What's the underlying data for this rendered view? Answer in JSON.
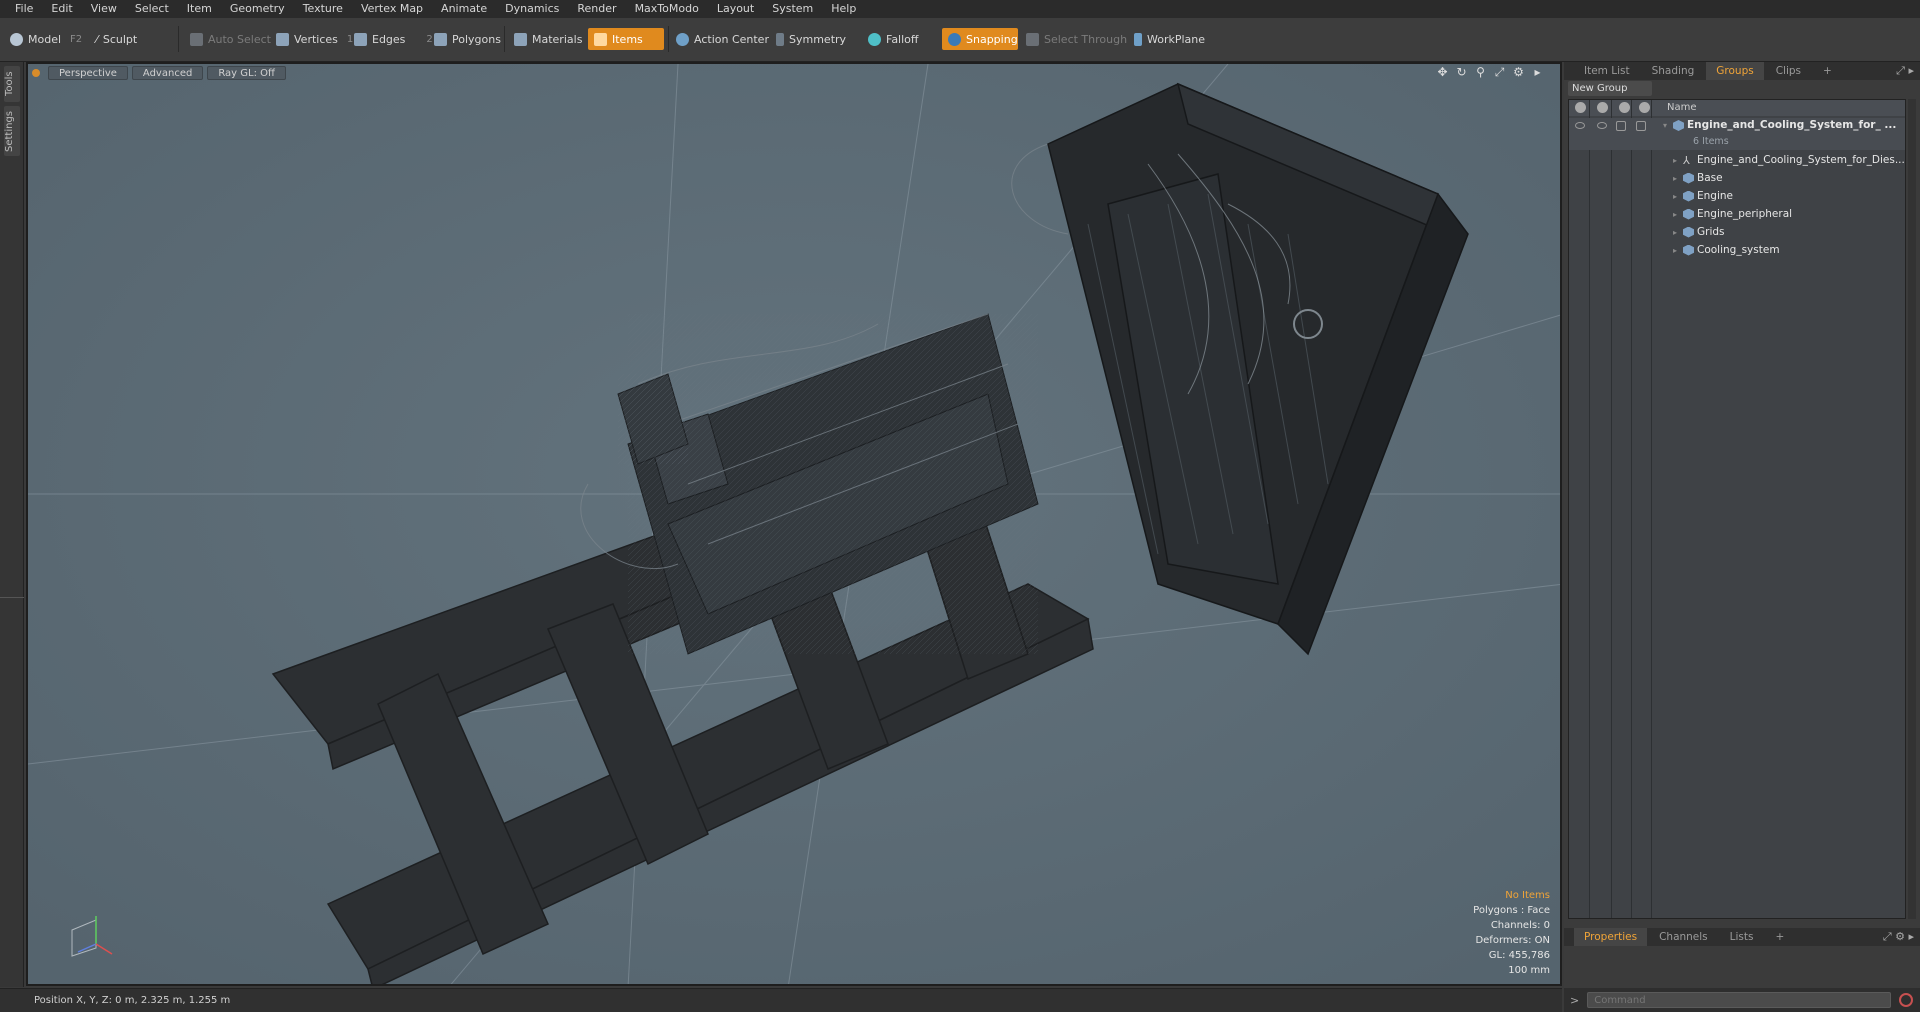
{
  "menu": [
    "File",
    "Edit",
    "View",
    "Select",
    "Item",
    "Geometry",
    "Texture",
    "Vertex Map",
    "Animate",
    "Dynamics",
    "Render",
    "MaxToModo",
    "Layout",
    "System",
    "Help"
  ],
  "toolbar": {
    "model": "Model",
    "model_key": "F2",
    "sculpt": "Sculpt",
    "auto_select": "Auto Select",
    "vertices": "Vertices",
    "vertices_key": "1",
    "edges": "Edges",
    "edges_key": "2",
    "polygons": "Polygons",
    "materials": "Materials",
    "items": "Items",
    "action_center": "Action Center",
    "symmetry": "Symmetry",
    "falloff": "Falloff",
    "snapping": "Snapping",
    "select_through": "Select Through",
    "workplane": "WorkPlane",
    "accent": "#e08a1e"
  },
  "left_tabs": [
    "Tools",
    "Settings"
  ],
  "viewport": {
    "view": "Perspective",
    "advanced": "Advanced",
    "raygl": "Ray GL: Off",
    "info": {
      "items": "No Items",
      "polygons": "Polygons : Face",
      "channels": "Channels: 0",
      "deformers": "Deformers: ON",
      "gl": "GL: 455,786",
      "scale": "100 mm"
    }
  },
  "statusbar": {
    "position": "Position X, Y, Z:   0 m, 2.325 m, 1.255 m"
  },
  "right_panel": {
    "tabs": [
      "Item List",
      "Shading",
      "Groups",
      "Clips"
    ],
    "active_tab": "Groups",
    "new_group": "New Group",
    "name_header": "Name",
    "group": {
      "name": "Engine_and_Cooling_System_for_ ...",
      "count": "6 Items"
    },
    "items": [
      {
        "label": "Engine_and_Cooling_System_for_Dies...",
        "icon": "locator-icon"
      },
      {
        "label": "Base",
        "icon": "mesh-icon"
      },
      {
        "label": "Engine",
        "icon": "mesh-icon"
      },
      {
        "label": "Engine_peripheral",
        "icon": "mesh-icon"
      },
      {
        "label": "Grids",
        "icon": "mesh-icon"
      },
      {
        "label": "Cooling_system",
        "icon": "mesh-icon"
      }
    ],
    "bottom_tabs": [
      "Properties",
      "Channels",
      "Lists"
    ],
    "active_bottom_tab": "Properties",
    "command_placeholder": "Command"
  }
}
